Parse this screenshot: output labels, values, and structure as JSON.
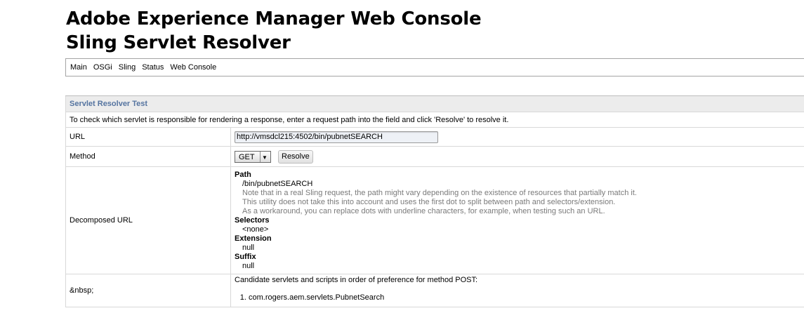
{
  "header": {
    "title_line1": "Adobe Experience Manager Web Console",
    "title_line2": "Sling Servlet Resolver"
  },
  "nav": [
    "Main",
    "OSGi",
    "Sling",
    "Status",
    "Web Console"
  ],
  "panel": {
    "heading": "Servlet Resolver Test",
    "intro": "To check which servlet is responsible for rendering a response, enter a request path into the field and click 'Resolve' to resolve it.",
    "url_label": "URL",
    "url_value": "http://vmsdcl215:4502/bin/pubnetSEARCH",
    "method_label": "Method",
    "method_value": "GET",
    "resolve_label": "Resolve",
    "decomposed_label": "Decomposed URL",
    "path_label": "Path",
    "path_value": "/bin/pubnetSEARCH",
    "notes": [
      "Note that in a real Sling request, the path might vary depending on the existence of resources that partially match it.",
      "This utility does not take this into account and uses the first dot to split between path and selectors/extension.",
      "As a workaround, you can replace dots with underline characters, for example, when testing such an URL."
    ],
    "selectors_label": "Selectors",
    "selectors_value": "<none>",
    "extension_label": "Extension",
    "extension_value": "null",
    "suffix_label": "Suffix",
    "suffix_value": "null",
    "candidates_row_label": "&nbsp;",
    "candidates_intro": "Candidate servlets and scripts in order of preference for method POST:",
    "candidates": [
      "com.rogers.aem.servlets.PubnetSearch"
    ]
  }
}
